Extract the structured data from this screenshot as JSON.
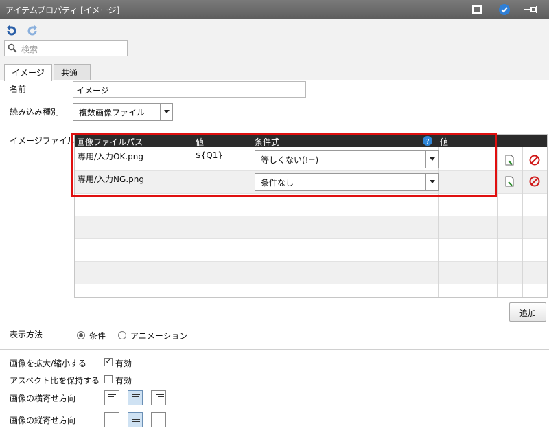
{
  "window": {
    "title": "アイテムプロパティ [イメージ]"
  },
  "search": {
    "placeholder": "検索"
  },
  "tabs": [
    {
      "label": "イメージ"
    },
    {
      "label": "共通"
    }
  ],
  "form": {
    "name_label": "名前",
    "name_value": "イメージ",
    "read_type_label": "読み込み種別",
    "read_type_value": "複数画像ファイル",
    "image_file_label": "イメージファイル"
  },
  "table": {
    "headers": [
      "画像ファイルパス",
      "値",
      "条件式",
      "値"
    ],
    "rows": [
      {
        "path": "専用/入力OK.png",
        "value": "${Q1}",
        "condition": "等しくない(!=)",
        "value2": ""
      },
      {
        "path": "専用/入力NG.png",
        "value": "",
        "condition": "条件なし",
        "value2": ""
      }
    ]
  },
  "add_button": "追加",
  "display": {
    "label": "表示方法",
    "options": [
      "条件",
      "アニメーション"
    ],
    "selected": "条件"
  },
  "options": {
    "scale_label": "画像を拡大/縮小する",
    "scale_check": "有効",
    "scale_checked": true,
    "aspect_label": "アスペクト比を保持する",
    "aspect_check": "有効",
    "aspect_checked": false,
    "halign_label": "画像の横寄せ方向",
    "valign_label": "画像の縦寄せ方向"
  },
  "colors": {
    "highlight": "#e01010",
    "header_bg": "#2b2b2b",
    "titlebar": "#6a6a6a"
  }
}
